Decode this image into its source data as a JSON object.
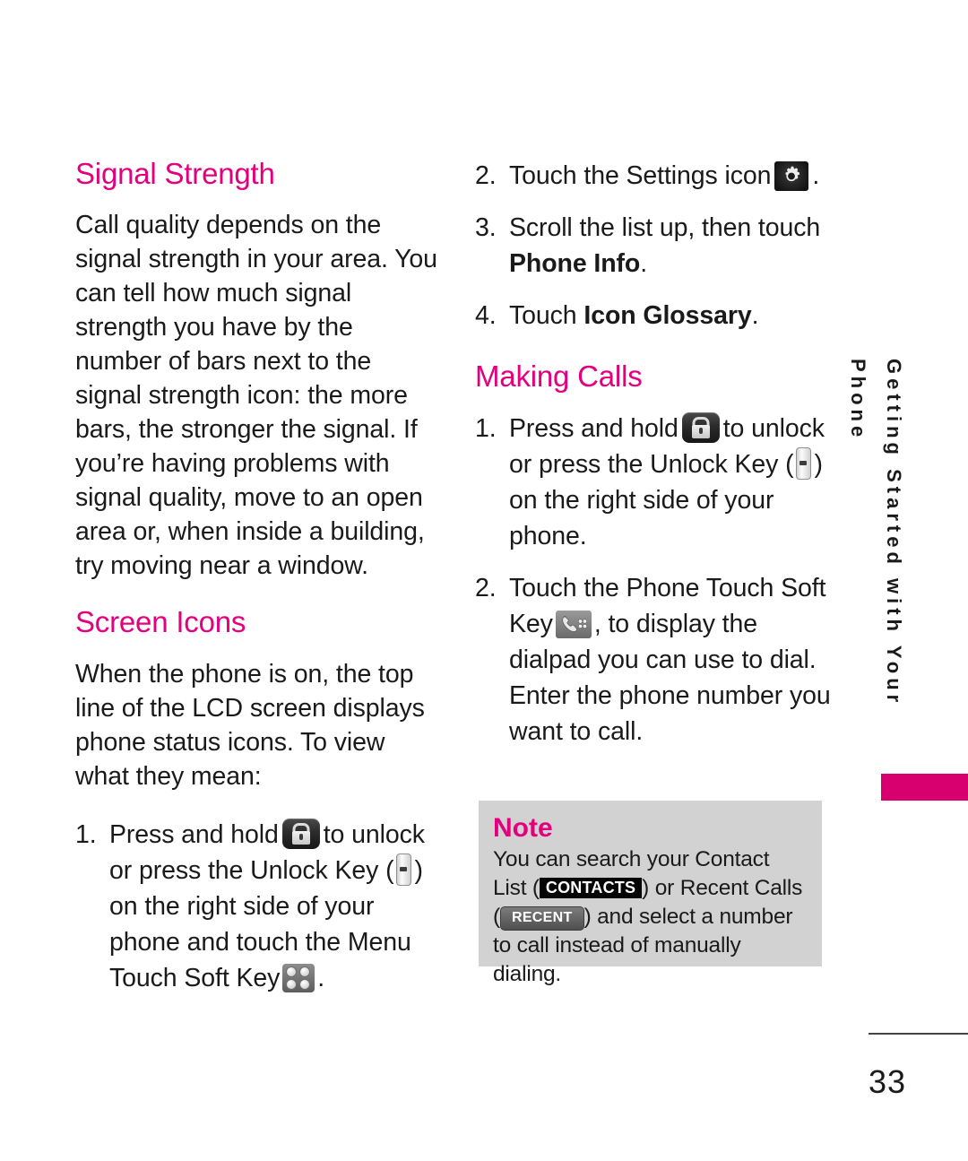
{
  "page": {
    "number": "33",
    "side_tab_label": "Getting Started with Your Phone",
    "accent_pink": "#e2007f",
    "tab_pink": "#d8006e",
    "note_bg": "#d2d2d2"
  },
  "left_column": {
    "signal_strength": {
      "heading": "Signal Strength",
      "paragraph": "Call quality depends on the signal strength in your area. You can tell how much signal strength you have by the number of bars next to the signal strength icon: the more bars, the stronger the signal. If you’re having problems with signal quality, move to an open area or, when inside a building, try moving near a window."
    },
    "screen_icons": {
      "heading": "Screen Icons",
      "paragraph": "When the phone is on, the top line of the LCD screen displays phone status icons. To view what they mean:",
      "step1": {
        "number": "1.",
        "part_a": "Press and hold",
        "part_b": "to unlock or press the Unlock Key (",
        "part_c": ") on the right side of your phone and touch the Menu Touch Soft Key",
        "part_d": "."
      }
    }
  },
  "right_column": {
    "continued_steps": {
      "step2": {
        "number": "2.",
        "part_a": "Touch the Settings icon",
        "part_b": "."
      },
      "step3": {
        "number": "3.",
        "part_a": "Scroll the list up, then touch",
        "bold": "Phone Info",
        "part_b": "."
      },
      "step4": {
        "number": "4.",
        "part_a": "Touch",
        "bold": "Icon Glossary",
        "part_b": "."
      }
    },
    "making_calls": {
      "heading": "Making Calls",
      "step1": {
        "number": "1.",
        "part_a": "Press and hold",
        "part_b": "to unlock or press the Unlock Key (",
        "part_c": ") on the right side of your phone."
      },
      "step2": {
        "number": "2.",
        "part_a": "Touch the Phone Touch Soft Key",
        "part_b": ", to display the dialpad you can use to dial. Enter the phone number you want to call."
      }
    },
    "note": {
      "title": "Note",
      "text_a": "You can search your Contact List (",
      "contacts_label": "CONTACTS",
      "text_b": ") or Recent Calls (",
      "recent_label": "RECENT",
      "text_c": ") and select a number to call instead of manually dialing."
    }
  }
}
